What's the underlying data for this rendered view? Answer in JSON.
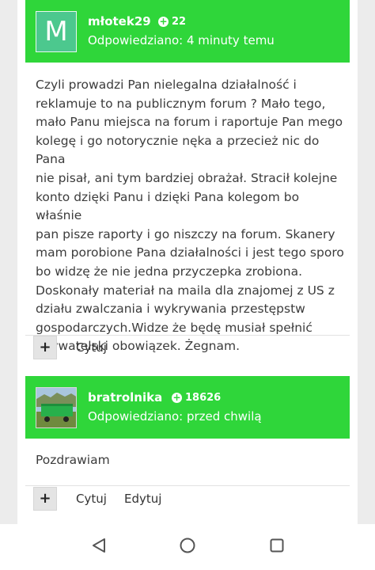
{
  "posts": [
    {
      "username": "młotek29",
      "avatar_letter": "M",
      "reputation": "22",
      "answered": "Odpowiedziano: 4 minuty temu",
      "body_lines": [
        "Czyli prowadzi Pan  nielegalna działalność i",
        "reklamuje to na publicznym forum ? Mało tego,",
        "mało Panu miejsca na forum i raportuje Pan mego",
        "kolegę i go notorycznie nęka a przecież nic do Pana",
        "nie pisał, ani tym bardziej obrażał. Stracił kolejne",
        "konto dzięki Panu i dzięki Pana kolegom  bo właśnie",
        "pan pisze raporty i go niszczy na forum. Skanery",
        "mam porobione Pana działalności i jest tego sporo",
        "bo widzę że nie jedna przyczepka zrobiona.",
        "Doskonały materiał na maila dla znajomej z US z",
        "działu zwalczania i wykrywania przestępstw",
        "gospodarczych.Widze że będę musiał spełnić",
        "obywatelski obowiązek. Żegnam."
      ],
      "actions": {
        "plus": "+",
        "quote": "Cytuj"
      }
    },
    {
      "username": "bratrolnika",
      "reputation": "18626",
      "answered": "Odpowiedziano: przed chwilą",
      "body": "Pozdrawiam",
      "actions": {
        "plus": "+",
        "quote": "Cytuj",
        "edit": "Edytuj"
      }
    }
  ],
  "colors": {
    "header_green": "#2fd63a",
    "avatar_teal": "#4cc88e"
  },
  "navbar": {
    "icons": [
      "back-icon",
      "home-icon",
      "recent-apps-icon"
    ]
  }
}
